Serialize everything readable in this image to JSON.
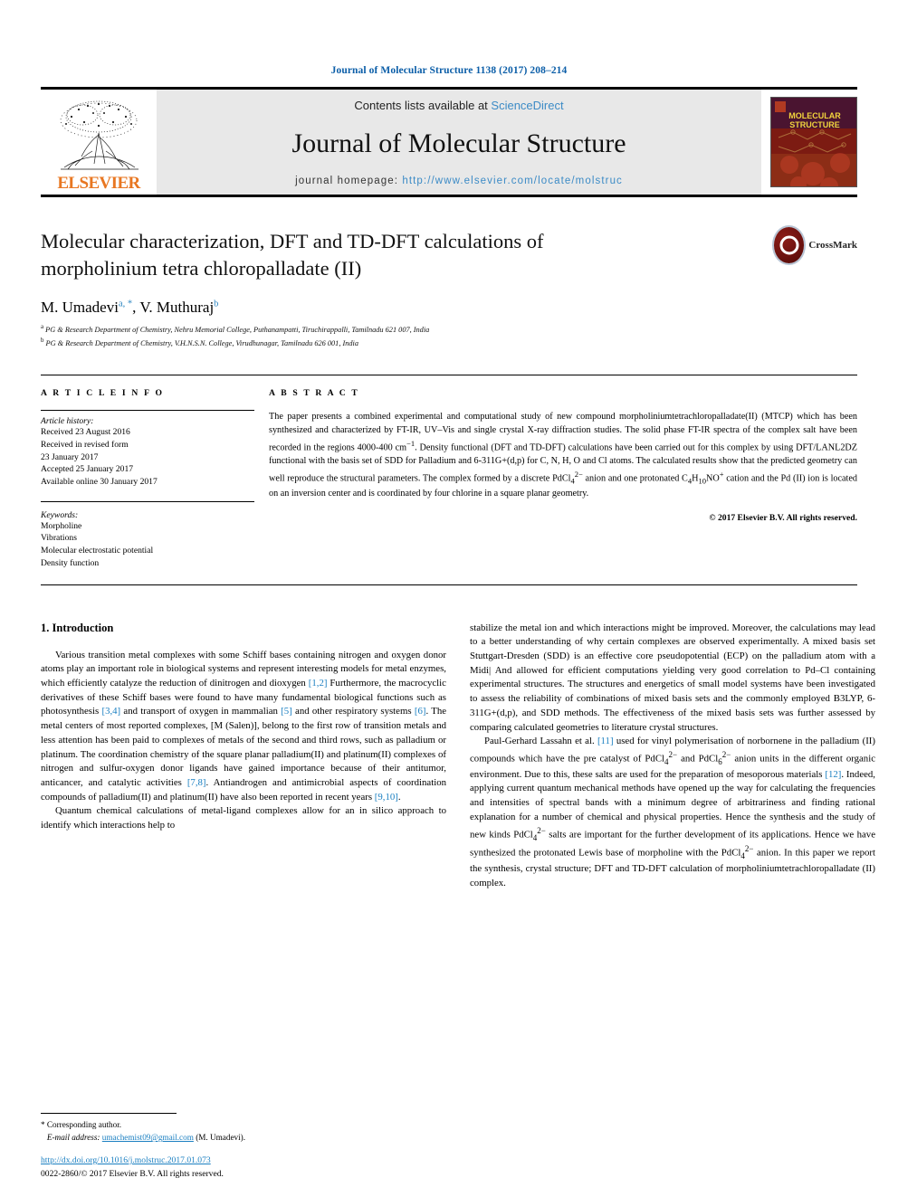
{
  "running_head": "Journal of Molecular Structure 1138 (2017) 208–214",
  "masthead": {
    "contents_prefix": "Contents lists available at ",
    "sciencedirect": "ScienceDirect",
    "journal_name": "Journal of Molecular Structure",
    "homepage_label": "journal homepage: ",
    "homepage_url": "http://www.elsevier.com/locate/molstruc",
    "publisher": "ELSEVIER",
    "cover_line1": "MOLECULAR",
    "cover_line2": "STRUCTURE",
    "link_color": "#3c8bc6"
  },
  "article": {
    "title": "Molecular characterization, DFT and TD-DFT calculations of morpholinium tetra chloropalladate (II)",
    "authors": [
      {
        "name": "M. Umadevi",
        "marks": "a, *"
      },
      {
        "name": "V. Muthuraj",
        "marks": "b"
      }
    ],
    "affiliations": [
      {
        "mark": "a",
        "text": "PG & Research Department of Chemistry, Nehru Memorial College, Puthanampatti, Tiruchirappalli, Tamilnadu 621 007, India"
      },
      {
        "mark": "b",
        "text": "PG & Research Department of Chemistry, V.H.N.S.N. College, Virudhunagar, Tamilnadu 626 001, India"
      }
    ],
    "crossmark_label": "CrossMark"
  },
  "info": {
    "heading": "A R T I C L E   I N F O",
    "history_title": "Article history:",
    "history": [
      "Received 23 August 2016",
      "Received in revised form",
      "23 January 2017",
      "Accepted 25 January 2017",
      "Available online 30 January 2017"
    ],
    "keywords_title": "Keywords:",
    "keywords": [
      "Morpholine",
      "Vibrations",
      "Molecular electrostatic potential",
      "Density function"
    ]
  },
  "abstract": {
    "heading": "A B S T R A C T",
    "text": "The paper presents a combined experimental and computational study of new compound morpholiniumtetrachloropalladate(II) (MTCP) which has been synthesized and characterized by FT-IR, UV–Vis and single crystal X-ray diffraction studies. The solid phase FT-IR spectra of the complex salt have been recorded in the regions 4000-400 cm−1. Density functional (DFT and TD-DFT) calculations have been carried out for this complex by using DFT/LANL2DZ functional with the basis set of SDD for Palladium and 6-311G+(d,p) for C, N, H, O and Cl atoms. The calculated results show that the predicted geometry can well reproduce the structural parameters. The complex formed by a discrete PdCl4 2− anion and one protonated C4H10NO+ cation and the Pd (II) ion is located on an inversion center and is coordinated by four chlorine in a square planar geometry.",
    "copyright": "© 2017 Elsevier B.V. All rights reserved."
  },
  "body": {
    "section_heading": "1. Introduction",
    "left_paragraphs": [
      "Various transition metal complexes with some Schiff bases containing nitrogen and oxygen donor atoms play an important role in biological systems and represent interesting models for metal enzymes, which efficiently catalyze the reduction of dinitrogen and dioxygen [1,2] Furthermore, the macrocyclic derivatives of these Schiff bases were found to have many fundamental biological functions such as photosynthesis [3,4] and transport of oxygen in mammalian [5] and other respiratory systems [6]. The metal centers of most reported complexes, [M (Salen)], belong to the first row of transition metals and less attention has been paid to complexes of metals of the second and third rows, such as palladium or platinum. The coordination chemistry of the square planar palladium(II) and platinum(II) complexes of nitrogen and sulfur-oxygen donor ligands have gained importance because of their antitumor, anticancer, and catalytic activities [7,8]. Antiandrogen and antimicrobial aspects of coordination compounds of palladium(II) and platinum(II) have also been reported in recent years [9,10].",
      "Quantum chemical calculations of metal-ligand complexes allow for an in silico approach to identify which interactions help to"
    ],
    "right_paragraphs": [
      "stabilize the metal ion and which interactions might be improved. Moreover, the calculations may lead to a better understanding of why certain complexes are observed experimentally. A mixed basis set Stuttgart-Dresden (SDD) is an effective core pseudopotential (ECP) on the palladium atom with a Midi| And allowed for efficient computations yielding very good correlation to Pd–Cl containing experimental structures. The structures and energetics of small model systems have been investigated to assess the reliability of combinations of mixed basis sets and the commonly employed B3LYP, 6-311G+(d,p), and SDD methods. The effectiveness of the mixed basis sets was further assessed by comparing calculated geometries to literature crystal structures.",
      "Paul-Gerhard Lassahn et al. [11] used for vinyl polymerisation of norbornene in the palladium (II) compounds which have the pre catalyst of PdCl4 2− and PdCl6 2− anion units in the different organic environment. Due to this, these salts are used for the preparation of mesoporous materials [12]. Indeed, applying current quantum mechanical methods have opened up the way for calculating the frequencies and intensities of spectral bands with a minimum degree of arbitrariness and finding rational explanation for a number of chemical and physical properties. Hence the synthesis and the study of new kinds PdCl4 2− salts are important for the further development of its applications. Hence we have synthesized the protonated Lewis base of morpholine with the PdCl4 2− anion. In this paper we report the synthesis, crystal structure; DFT and TD-DFT calculation of morpholiniumtetrachloropalladate (II) complex."
    ]
  },
  "footnote": {
    "corresponding": "* Corresponding author.",
    "email_label": "E-mail address:",
    "email": "umachemist09@gmail.com",
    "email_person": "(M. Umadevi)."
  },
  "doc_footer": {
    "doi": "http://dx.doi.org/10.1016/j.molstruc.2017.01.073",
    "issn_line": "0022-2860/© 2017 Elsevier B.V. All rights reserved."
  }
}
